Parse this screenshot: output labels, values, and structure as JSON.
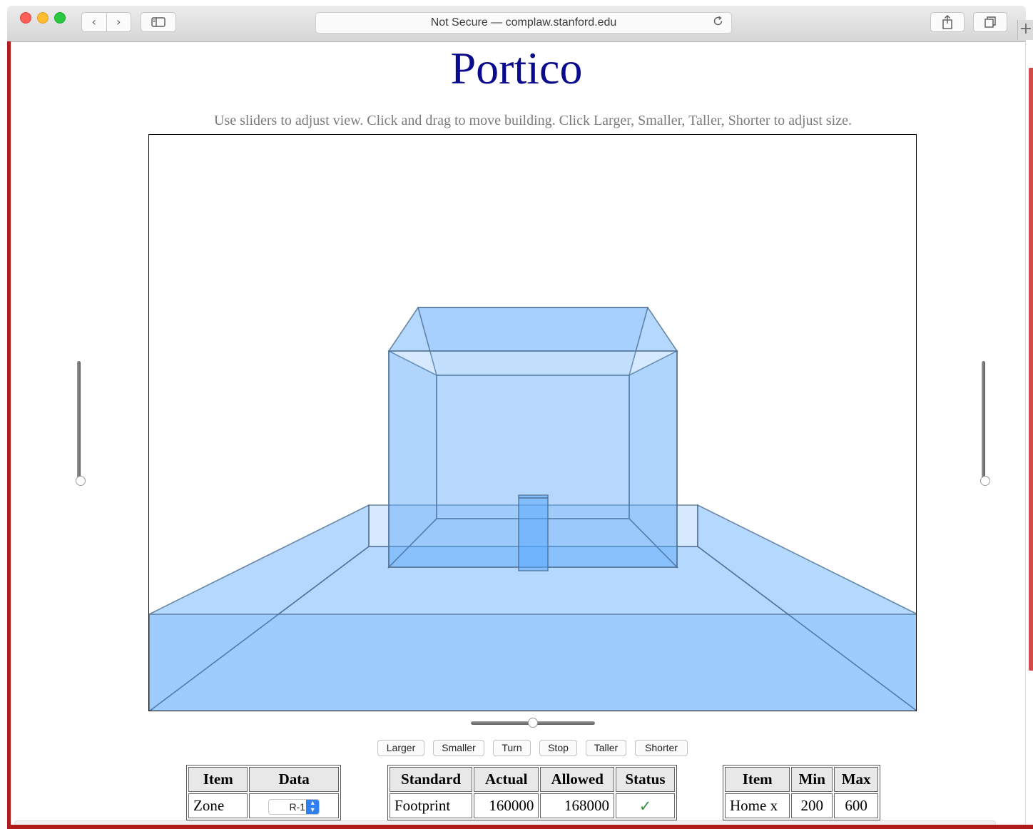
{
  "browser": {
    "address_text": "Not Secure — complaw.stanford.edu",
    "back_glyph": "‹",
    "forward_glyph": "›",
    "new_tab_glyph": "+",
    "icons": [
      "back-icon",
      "forward-icon",
      "sidebar-icon",
      "reload-icon",
      "share-icon",
      "tabs-icon"
    ]
  },
  "page": {
    "title": "Portico",
    "instructions": "Use sliders to adjust view. Click and drag to move building. Click Larger, Smaller, Turn, Stop, Taller, Shorter to adjust size.",
    "instructions_shown": "Use sliders to adjust view. Click and drag to move building. Click Larger, Smaller, Taller, Shorter to adjust size."
  },
  "view": {
    "fill_color": "#5aa9fc",
    "edge_color": "#4e6e8f",
    "left_slider_level": 0,
    "right_slider_level": 0,
    "bottom_slider_level": 0.5
  },
  "controls": {
    "larger": "Larger",
    "smaller": "Smaller",
    "turn": "Turn",
    "stop": "Stop",
    "taller": "Taller",
    "shorter": "Shorter"
  },
  "zone_table": {
    "headers": [
      "Item",
      "Data"
    ],
    "rows": [
      {
        "item": "Zone",
        "value": "R-1"
      }
    ]
  },
  "standards_table": {
    "headers": [
      "Standard",
      "Actual",
      "Allowed",
      "Status"
    ],
    "rows": [
      {
        "standard": "Footprint",
        "actual": "160000",
        "allowed": "168000",
        "status": "✓"
      }
    ]
  },
  "limits_table": {
    "headers": [
      "Item",
      "Min",
      "Max"
    ],
    "rows": [
      {
        "item": "Home x",
        "min": "200",
        "max": "600"
      }
    ]
  }
}
